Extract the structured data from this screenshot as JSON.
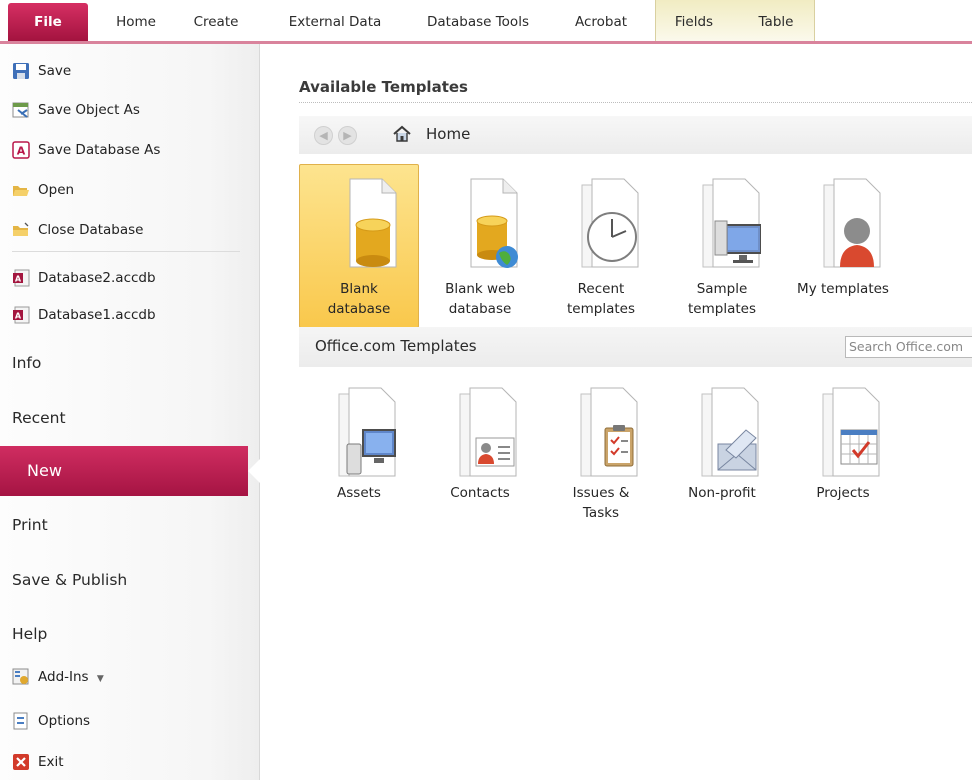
{
  "ribbon": {
    "tabs": [
      "File",
      "Home",
      "Create",
      "External Data",
      "Database Tools",
      "Acrobat",
      "Fields",
      "Table"
    ],
    "accent": "#b8174a"
  },
  "nav": {
    "commands": [
      "Save",
      "Save Object As",
      "Save Database As",
      "Open",
      "Close Database"
    ],
    "recent_files": [
      "Database2.accdb",
      "Database1.accdb"
    ],
    "tabs": [
      "Info",
      "Recent",
      "New",
      "Print",
      "Save & Publish",
      "Help"
    ],
    "selected_tab": "New",
    "addins": "Add-Ins",
    "options": "Options",
    "exit": "Exit"
  },
  "main": {
    "available_title": "Available Templates",
    "location": "Home",
    "templates": [
      {
        "line1": "Blank",
        "line2": "database",
        "icon": "blank-database-icon"
      },
      {
        "line1": "Blank web",
        "line2": "database",
        "icon": "blank-web-database-icon"
      },
      {
        "line1": "Recent",
        "line2": "templates",
        "icon": "clock-icon"
      },
      {
        "line1": "Sample",
        "line2": "templates",
        "icon": "monitor-icon"
      },
      {
        "line1": "My templates",
        "line2": "",
        "icon": "person-icon"
      }
    ],
    "office_title": "Office.com Templates",
    "office_search_placeholder": "Search Office.com",
    "office_templates": [
      {
        "line1": "Assets",
        "line2": "",
        "icon": "computer-icon"
      },
      {
        "line1": "Contacts",
        "line2": "",
        "icon": "contact-card-icon"
      },
      {
        "line1": "Issues &",
        "line2": "Tasks",
        "icon": "clipboard-icon"
      },
      {
        "line1": "Non-profit",
        "line2": "",
        "icon": "envelope-icon"
      },
      {
        "line1": "Projects",
        "line2": "",
        "icon": "calendar-icon"
      }
    ]
  }
}
